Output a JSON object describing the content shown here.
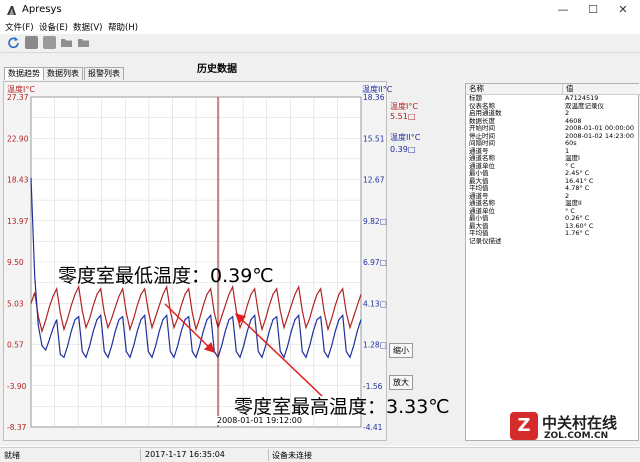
{
  "window": {
    "title": "Apresys",
    "minimize": "—",
    "maximize": "☐",
    "close": "✕"
  },
  "menu": [
    {
      "label": "文件(F)"
    },
    {
      "label": "设备(E)"
    },
    {
      "label": "数据(V)"
    },
    {
      "label": "帮助(H)"
    }
  ],
  "tabs": [
    {
      "label": "数据趋势"
    },
    {
      "label": "数据列表"
    },
    {
      "label": "报警列表"
    }
  ],
  "page_title": "历史数据",
  "toolbar": {
    "icons": [
      "refresh-icon",
      "save-icon",
      "open-icon",
      "folder-icon",
      "folder-icon"
    ]
  },
  "colors": {
    "red_series": "#b22222",
    "blue_series": "#1f2f9c",
    "cursor": "#8b1a1a",
    "callout_arrow": "#e02020"
  },
  "chart_data": {
    "type": "line",
    "left_axis": {
      "label": "温度I°C",
      "ticks": [
        "27.37",
        "22.90",
        "18.43",
        "13.97",
        "9.50",
        "5.03",
        "0.57",
        "-3.90",
        "-8.37"
      ],
      "ylim": [
        -8.37,
        27.37
      ]
    },
    "right_axis": {
      "label": "温度II°C",
      "ticks": [
        "18.36",
        "15.51",
        "12.67",
        "9.82□",
        "6.97□",
        "4.13□",
        "1.28□",
        "-1.56",
        "-4.41"
      ],
      "ylim": [
        -4.41,
        18.36
      ]
    },
    "legend": [
      {
        "name": "温度I°C",
        "value": "5.51□",
        "color": "#b22222"
      },
      {
        "name": "温度II°C",
        "value": "0.39□",
        "color": "#1f2f9c"
      }
    ],
    "cursor_label": "2008-01-01 19:12:00",
    "grid": true,
    "series": [
      {
        "name": "温度I°C",
        "color": "#b22222",
        "values": [
          5.0,
          6.2,
          3.6,
          2.0,
          3.2,
          4.6,
          5.8,
          6.6,
          4.0,
          2.2,
          3.4,
          4.8,
          6.0,
          6.8,
          4.2,
          2.4,
          3.4,
          4.8,
          6.0,
          6.6,
          4.0,
          2.4,
          3.4,
          4.6,
          5.8,
          6.6,
          4.0,
          2.2,
          3.4,
          4.8,
          6.0,
          6.6,
          4.2,
          2.4,
          3.6,
          4.8,
          6.0,
          6.8,
          4.2,
          2.4,
          3.4,
          4.8,
          6.0,
          6.6,
          4.0,
          2.2,
          3.4,
          4.8,
          6.0,
          6.6,
          4.0,
          2.4,
          3.6,
          4.8,
          6.0,
          6.8,
          4.2,
          2.4,
          3.4,
          4.8,
          6.0,
          6.6,
          4.0,
          2.2,
          3.4,
          4.8,
          6.0,
          6.6,
          4.2,
          2.4,
          3.6,
          4.8,
          6.0,
          6.8,
          4.2,
          2.4,
          3.4,
          4.8,
          6.0,
          6.6,
          4.0,
          2.2,
          3.4,
          4.8,
          6.0,
          6.6,
          4.0,
          2.4,
          3.6,
          4.8,
          6.0
        ]
      },
      {
        "name": "温度II°C",
        "color": "#1f2f9c",
        "values": [
          12.8,
          6.0,
          2.6,
          1.2,
          0.9,
          1.6,
          2.4,
          3.0,
          0.6,
          0.4,
          1.2,
          2.2,
          3.0,
          3.2,
          0.8,
          0.4,
          1.2,
          2.2,
          3.0,
          3.3,
          0.8,
          0.4,
          1.2,
          2.2,
          3.0,
          3.2,
          0.8,
          0.4,
          1.2,
          2.2,
          3.0,
          3.3,
          0.8,
          0.4,
          1.2,
          2.2,
          3.0,
          3.3,
          0.8,
          0.4,
          1.2,
          2.2,
          3.0,
          3.2,
          0.8,
          0.4,
          1.2,
          2.2,
          3.0,
          3.3,
          0.8,
          0.4,
          1.2,
          2.2,
          3.0,
          3.2,
          0.8,
          0.4,
          1.2,
          2.2,
          3.0,
          3.3,
          0.8,
          0.4,
          1.2,
          2.2,
          3.0,
          3.2,
          0.8,
          0.4,
          1.2,
          2.2,
          3.0,
          3.3,
          0.8,
          0.4,
          1.2,
          2.2,
          3.0,
          3.2,
          0.8,
          0.4,
          1.2,
          2.2,
          3.0,
          3.3,
          0.8,
          0.4,
          1.2,
          2.2,
          3.0
        ]
      }
    ]
  },
  "buttons": {
    "zoom_out": "缩小",
    "zoom_in": "放大"
  },
  "annotations": {
    "min_callout": "零度室最低温度：0.39℃",
    "max_callout": "零度室最高温度：3.33℃"
  },
  "properties": {
    "headers": {
      "name": "名称",
      "value": "值"
    },
    "rows": [
      {
        "name": "标题",
        "value": "A7124519"
      },
      {
        "name": "仪表名称",
        "value": "双温度记录仪"
      },
      {
        "name": "启用通道数",
        "value": "2"
      },
      {
        "name": "数据长度",
        "value": "4608"
      },
      {
        "name": "开始时间",
        "value": "2008-01-01 00:00:00"
      },
      {
        "name": "停止时间",
        "value": "2008-01-02 14:23:00"
      },
      {
        "name": "间隔时间",
        "value": "60s"
      },
      {
        "name": "通道号",
        "value": "1"
      },
      {
        "name": "通道名称",
        "value": "温度I"
      },
      {
        "name": "通道单位",
        "value": "° C"
      },
      {
        "name": "最小值",
        "value": "2.45° C"
      },
      {
        "name": "最大值",
        "value": "16.41° C"
      },
      {
        "name": "平均值",
        "value": "4.78° C"
      },
      {
        "name": "通道号",
        "value": "2"
      },
      {
        "name": "通道名称",
        "value": "温度II"
      },
      {
        "name": "通道单位",
        "value": "° C"
      },
      {
        "name": "最小值",
        "value": "0.26° C"
      },
      {
        "name": "最大值",
        "value": "13.60° C"
      },
      {
        "name": "平均值",
        "value": "1.76° C"
      },
      {
        "name": "记录仪描述",
        "value": ""
      }
    ]
  },
  "status": [
    {
      "text": "就绪"
    },
    {
      "text": "2017-1-17 16:35:04"
    },
    {
      "text": "设备未连接"
    }
  ],
  "watermark": {
    "line1": "中关村在线",
    "line2": "ZOL.COM.CN"
  }
}
